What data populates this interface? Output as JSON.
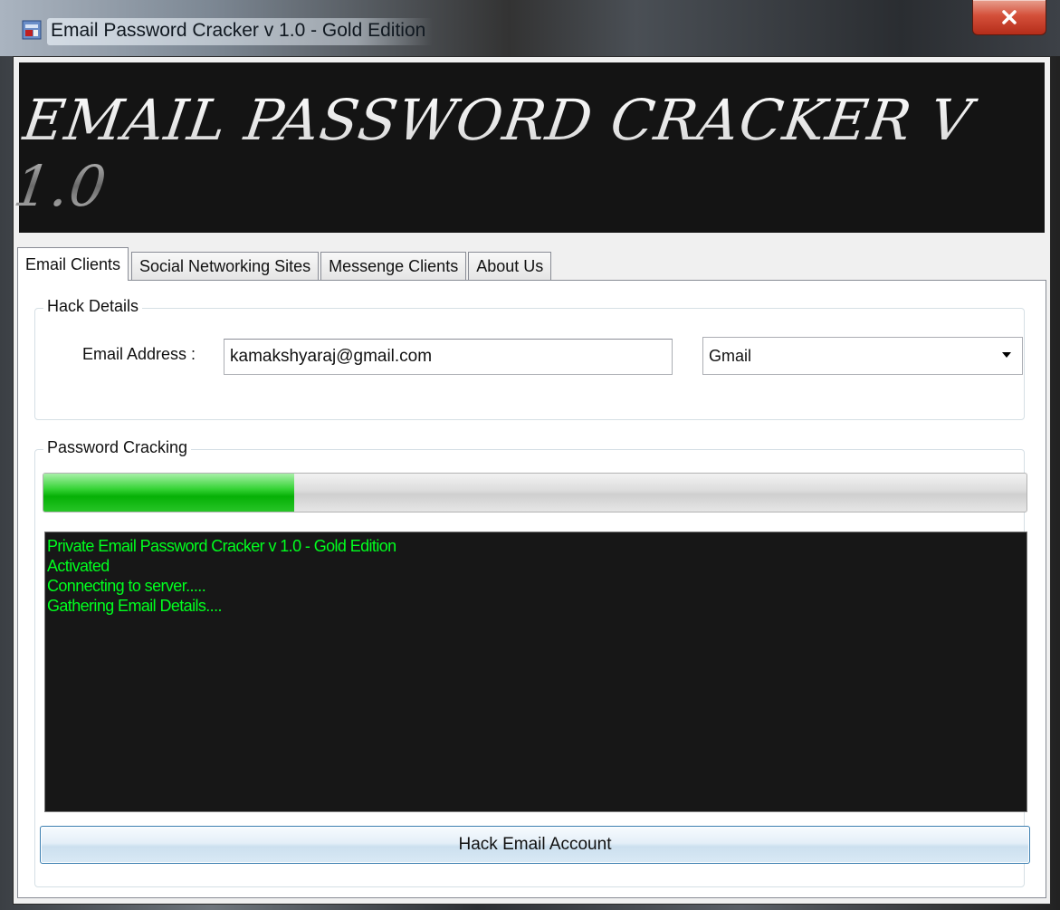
{
  "window": {
    "title": "Email Password Cracker v 1.0 - Gold Edition",
    "close_label": "x"
  },
  "banner": {
    "title": "EMAIL PASSWORD CRACKER V 1.0"
  },
  "tabs": [
    {
      "label": "Email Clients",
      "active": true
    },
    {
      "label": "Social Networking Sites",
      "active": false
    },
    {
      "label": "Messenge Clients",
      "active": false
    },
    {
      "label": "About Us",
      "active": false
    }
  ],
  "hack_details": {
    "group_label": "Hack Details",
    "email_label": "Email Address :",
    "email_value": "kamakshyaraj@gmail.com",
    "provider_selected": "Gmail"
  },
  "password_cracking": {
    "group_label": "Password Cracking",
    "progress_fraction": 0.255,
    "console_lines": [
      "Private Email Password Cracker v 1.0 - Gold Edition",
      "Activated",
      "Connecting to server.....",
      "Gathering Email Details...."
    ],
    "hack_button_label": "Hack Email Account"
  },
  "colors": {
    "console_text": "#00ff1e",
    "console_bg": "#171717",
    "progress_fill": "#06b006",
    "close_button": "#c8412c"
  }
}
